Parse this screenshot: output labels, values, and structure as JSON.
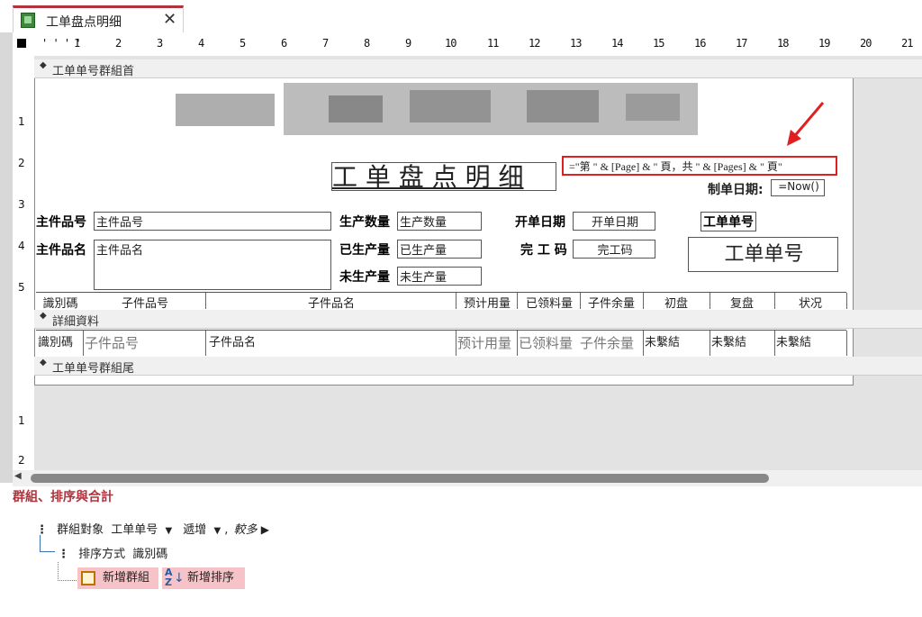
{
  "tab": {
    "title": "工单盘点明细",
    "close": "✕"
  },
  "ruler": {
    "marks": [
      "1",
      "2",
      "3",
      "4",
      "5",
      "6",
      "7",
      "8",
      "9",
      "10",
      "11",
      "12",
      "13",
      "14",
      "15",
      "16",
      "17",
      "18",
      "19",
      "20",
      "21"
    ]
  },
  "vruler": {
    "marks": [
      "1",
      "2",
      "3",
      "4",
      "5",
      "1",
      "2"
    ]
  },
  "sections": {
    "group_header": "工单单号群組首",
    "detail": "詳細資料",
    "group_footer": "工单单号群組尾"
  },
  "report": {
    "title": "工 单 盘 点 明 细",
    "page_expr": "=\"第 \" & [Page] & \" 頁，共 \" & [Pages] & \" 頁\"",
    "date_label": "制单日期:",
    "date_value": "=Now()",
    "fields": {
      "main_part_no_label": "主件品号",
      "main_part_no": "主件品号",
      "main_part_name_label": "主件品名",
      "main_part_name": "主件品名",
      "prod_qty_label": "生产数量",
      "prod_qty": "生产数量",
      "produced_qty_label": "已生产量",
      "produced_qty": "已生产量",
      "unproduced_qty_label": "未生产量",
      "unproduced_qty": "未生产量",
      "open_date_label": "开单日期",
      "open_date": "开单日期",
      "finish_code_label": "完 工 码",
      "finish_code": "完工码",
      "wo_no_label": "工单单号",
      "wo_no_big": "工单单号"
    },
    "columns": [
      "識別碼",
      "子件品号",
      "子件品名",
      "预计用量",
      "已领料量",
      "子件余量",
      "初盘",
      "复盘",
      "状况"
    ],
    "detail_row": [
      "識別碼",
      "子件品号",
      "子件品名",
      "预计用量",
      "已领料量",
      "子件余量",
      "未繫結",
      "未繫結",
      "未繫結"
    ]
  },
  "grouping": {
    "title": "群組、排序與合計",
    "group_by_prefix": "群組對象",
    "group_by_field": "工单单号",
    "group_order": "遞增",
    "more": "較多",
    "sort_prefix": "排序方式",
    "sort_field": "識別碼",
    "add_group": "新增群組",
    "add_sort": "新增排序"
  },
  "colors": {
    "accent": "#b0323b",
    "highlight_box": "#e02020",
    "arrow": "#e02020",
    "pink_btn": "#f6c4c8"
  }
}
